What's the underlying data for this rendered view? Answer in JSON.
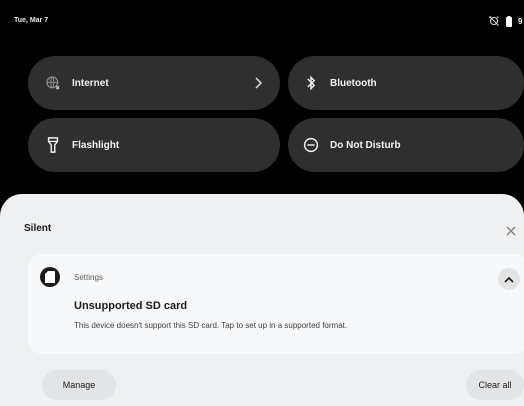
{
  "status_bar": {
    "date": "Tue, Mar 7",
    "battery_text": "9",
    "icons": [
      "alarm-off-icon",
      "battery-icon"
    ]
  },
  "quick_settings": {
    "tiles": [
      {
        "label": "Internet",
        "icon": "globe-icon",
        "has_chevron": true
      },
      {
        "label": "Bluetooth",
        "icon": "bluetooth-icon"
      },
      {
        "label": "Flashlight",
        "icon": "flashlight-icon"
      },
      {
        "label": "Do Not Disturb",
        "icon": "do-not-disturb-icon"
      }
    ]
  },
  "notification_panel": {
    "section_title": "Silent",
    "notification": {
      "app_name": "Settings",
      "title": "Unsupported SD card",
      "body": "This device doesn't support this SD card. Tap to set up in a supported format."
    },
    "buttons": {
      "manage": "Manage",
      "clear_all": "Clear all"
    }
  },
  "colors": {
    "background": "#000000",
    "tile": "#2f2f2f",
    "sheet": "#eef0f1",
    "card": "#f7f8f9",
    "button": "#e2e4e6"
  }
}
